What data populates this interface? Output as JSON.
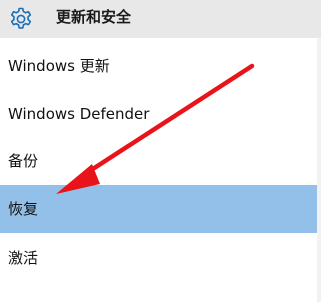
{
  "header": {
    "title": "更新和安全",
    "icon": "gear-icon"
  },
  "nav": {
    "items": [
      {
        "label": "Windows 更新",
        "selected": false
      },
      {
        "label": "Windows Defender",
        "selected": false
      },
      {
        "label": "备份",
        "selected": false
      },
      {
        "label": "恢复",
        "selected": true
      },
      {
        "label": "激活",
        "selected": false
      }
    ]
  },
  "colors": {
    "header_bg": "#e8e8e8",
    "accent": "#1a6fb8",
    "selected_bg": "#92c0e8",
    "annotation_arrow": "#e8141a"
  }
}
